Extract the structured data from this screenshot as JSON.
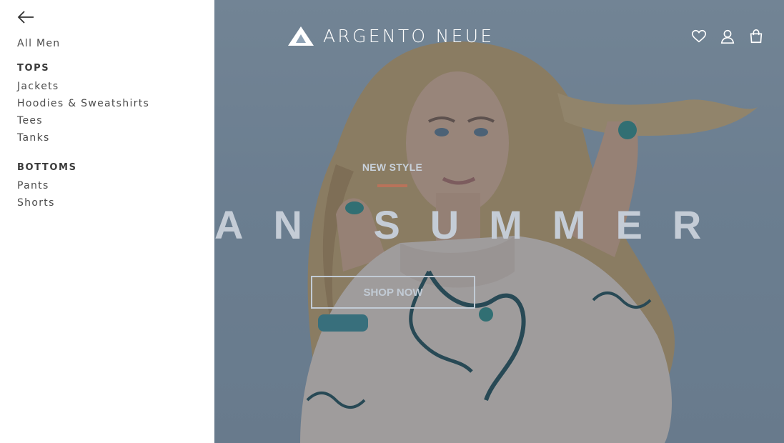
{
  "drawer": {
    "back_icon": "arrow-left-icon",
    "all_link": "All Men",
    "sections": [
      {
        "heading": "TOPS",
        "items": [
          "Jackets",
          "Hoodies & Sweatshirts",
          "Tees",
          "Tanks"
        ]
      },
      {
        "heading": "BOTTOMS",
        "items": [
          "Pants",
          "Shorts"
        ]
      }
    ]
  },
  "header": {
    "brand_name": "ARGENTO NEUE",
    "brand_icon": "triangle-logo-icon",
    "icons": [
      "heart-icon",
      "user-icon",
      "shopping-bag-icon"
    ]
  },
  "hero": {
    "eyebrow": "NEW STYLE",
    "headline": "AN SUMMER",
    "cta_label": "SHOP NOW",
    "accent_color": "#b9735a",
    "overlay_color": "#344254"
  }
}
